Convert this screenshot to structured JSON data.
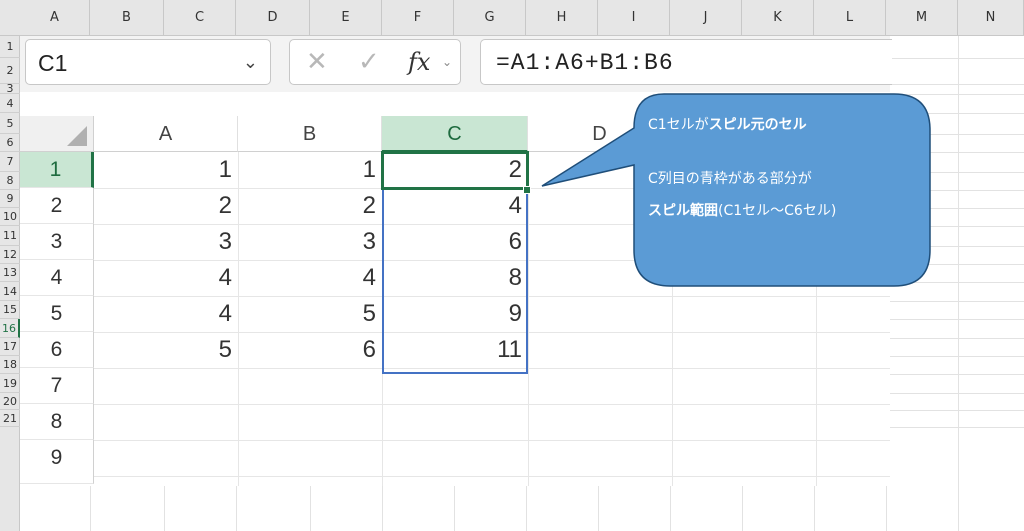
{
  "outer": {
    "columns": [
      "A",
      "B",
      "C",
      "D",
      "E",
      "F",
      "G",
      "H",
      "I",
      "J",
      "K",
      "L",
      "M",
      "N"
    ],
    "rows": [
      "1",
      "2",
      "3",
      "4",
      "5",
      "6",
      "7",
      "8",
      "9",
      "10",
      "11",
      "12",
      "13",
      "14",
      "15",
      "16",
      "17",
      "18",
      "19",
      "20",
      "21"
    ],
    "active_row": "16"
  },
  "formula_bar": {
    "name_box": "C1",
    "name_caret": "⌄",
    "cancel_icon": "✕",
    "enter_icon": "✓",
    "fx_label": "fx",
    "fx_caret": "⌄",
    "formula": "=A1:A6+B1:B6"
  },
  "sheet": {
    "columns": [
      "A",
      "B",
      "C",
      "D"
    ],
    "active_column": "C",
    "rows": [
      "1",
      "2",
      "3",
      "4",
      "5",
      "6",
      "7",
      "8",
      "9"
    ],
    "active_row": "1",
    "col_a": [
      "1",
      "2",
      "3",
      "4",
      "4",
      "5"
    ],
    "col_b": [
      "1",
      "2",
      "3",
      "4",
      "5",
      "6"
    ],
    "col_c": [
      "2",
      "4",
      "6",
      "8",
      "9",
      "11"
    ]
  },
  "callout": {
    "line1_pre": "C1セルが",
    "line1_bold": "スピル元のセル",
    "line2": "C列目の青枠がある部分が",
    "line3_bold": "スピル範囲",
    "line3_post": "(C1セル～C6セル)",
    "fill_color": "#5b9bd5",
    "border_color": "#1f4e79"
  },
  "colors": {
    "excel_green": "#217346",
    "spill_blue": "#4472c4"
  }
}
